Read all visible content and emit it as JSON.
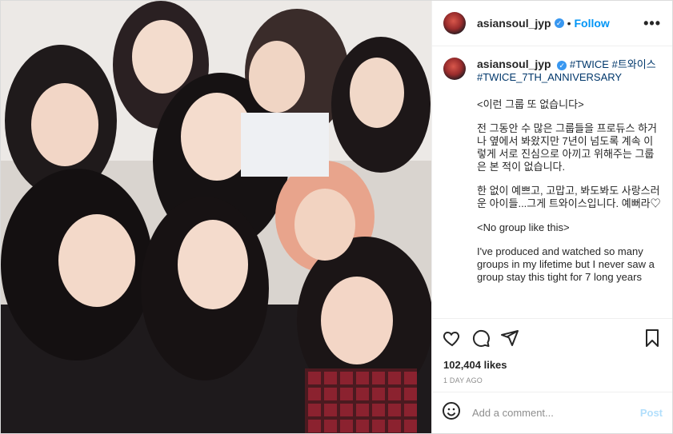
{
  "post": {
    "username": "asiansoul_jyp",
    "dot": "•",
    "follow_label": "Follow",
    "more_label": "•••",
    "caption": {
      "username": "asiansoul_jyp",
      "hashtags": [
        "#TWICE",
        "#트와이스",
        "#TWICE_7TH_ANNIVERSARY"
      ],
      "paragraphs": [
        "<이런 그룹 또 없습니다>",
        "전 그동안 수 많은 그룹들을 프로듀스 하거나 옆에서 봐왔지만 7년이 넘도록 계속 이렇게 서로 진심으로 아끼고 위해주는 그룹은 본 적이 없습니다.",
        "한 없이 예쁘고, 고맙고, 봐도봐도 사랑스러운 아이들...그게 트와이스입니다. 예뻐라♡",
        "<No group like this>",
        "I've produced and watched so many groups in my lifetime but I never saw a group stay this tight for 7 long years"
      ]
    },
    "likes": "102,404 likes",
    "time_ago": "1 DAY AGO",
    "comment_placeholder": "Add a comment...",
    "post_label": "Post",
    "icons": [
      "heart-icon",
      "comment-icon",
      "share-icon",
      "bookmark-icon",
      "emoji-icon",
      "verified-badge-icon"
    ],
    "colors": {
      "link": "#0095f6",
      "hashtag": "#00376b",
      "verified": "#3897f0",
      "post_disabled": "#b2dffc"
    }
  }
}
